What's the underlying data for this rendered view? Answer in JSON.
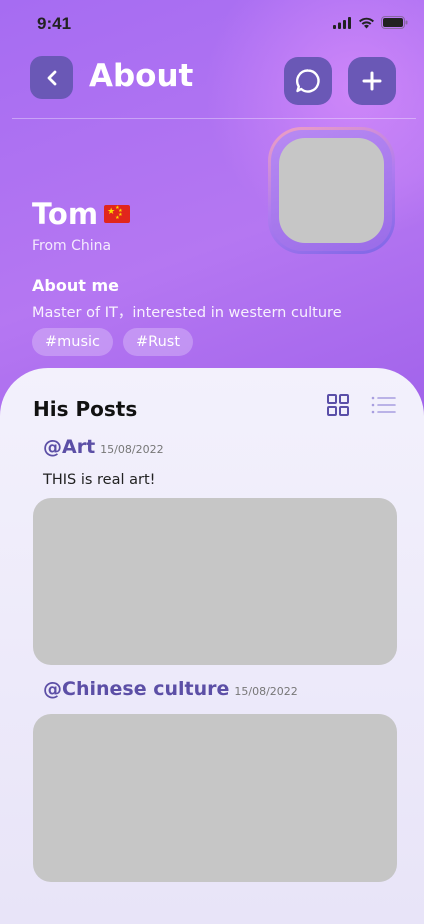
{
  "status": {
    "time": "9:41"
  },
  "header": {
    "title": "About"
  },
  "profile": {
    "name": "Tom",
    "origin": "From China",
    "about_heading": "About me",
    "about_text": "Master of IT，interested in western culture",
    "tags": [
      "#music",
      "#Rust"
    ]
  },
  "posts_section": {
    "title": "His Posts",
    "posts": [
      {
        "author": "@Art",
        "date": "15/08/2022",
        "caption": "THIS is real art!"
      },
      {
        "author": "@Chinese culture",
        "date": "15/08/2022"
      }
    ]
  },
  "colors": {
    "accent": "#6a58b6",
    "gradient_start": "#a66cf2",
    "gradient_end": "#8e55e4",
    "author_text": "#5c4fa6"
  },
  "icons": [
    "back-icon",
    "chat-icon",
    "plus-icon",
    "grid-icon",
    "list-icon",
    "china-flag-icon"
  ]
}
